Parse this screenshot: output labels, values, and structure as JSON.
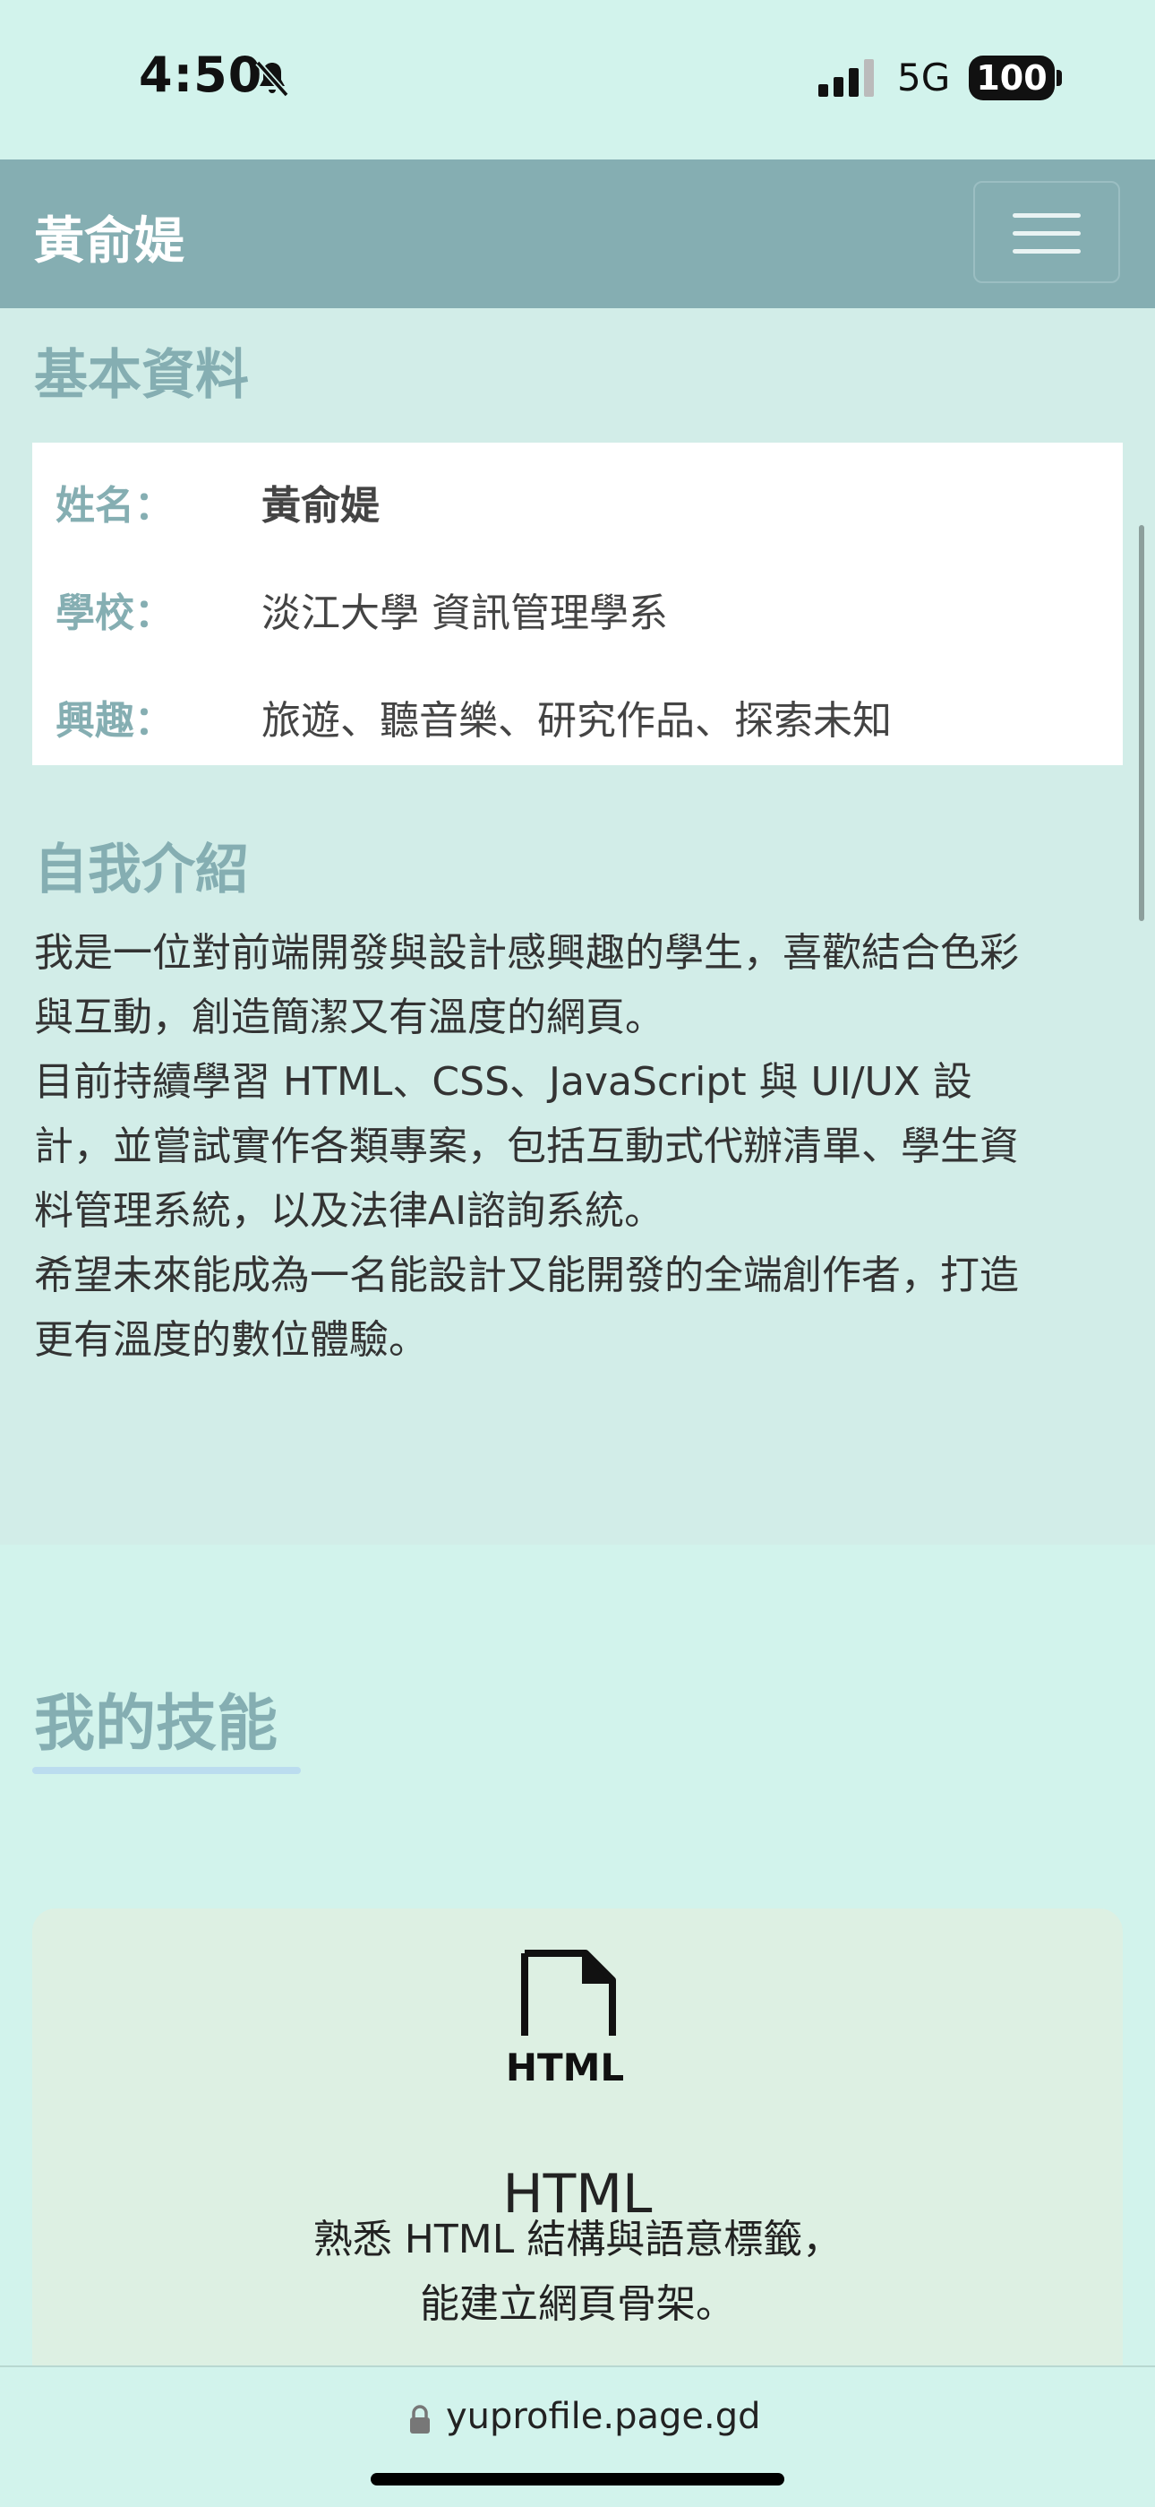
{
  "status_bar": {
    "time": "4:50",
    "network": "5G",
    "battery": "100"
  },
  "navbar": {
    "brand": "黃俞媞"
  },
  "about": {
    "basic_title": "基本資料",
    "info": [
      {
        "label": "姓名：",
        "value": "黃俞媞"
      },
      {
        "label": "學校：",
        "value": "淡江大學 資訊管理學系"
      },
      {
        "label": "興趣：",
        "value": "旅遊、聽音樂、研究作品、探索未知"
      }
    ],
    "intro_title": "自我介紹",
    "intro_lines": [
      "我是一位對前端開發與設計感興趣的學生，喜歡結合色彩",
      "與互動，創造簡潔又有溫度的網頁。",
      "目前持續學習 HTML、CSS、JavaScript 與 UI/UX 設",
      "計，並嘗試實作各類專案，包括互動式代辦清單、學生資",
      "料管理系統，以及法律AI諮詢系統。",
      "希望未來能成為一名能設計又能開發的全端創作者，打造",
      "更有溫度的數位體驗。"
    ]
  },
  "skills": {
    "title": "我的技能",
    "cards": [
      {
        "icon_label": "HTML",
        "name": "HTML",
        "desc_lines": [
          "熟悉 HTML 結構與語意標籤，",
          "能建立網頁骨架。"
        ]
      }
    ]
  },
  "browser": {
    "url": "yuprofile.page.gd"
  },
  "colors": {
    "accent": "#85aeb2",
    "navbar": "#85aeb2",
    "page_bg": "#d2f3ec",
    "card_bg": "#ddf0e3"
  }
}
